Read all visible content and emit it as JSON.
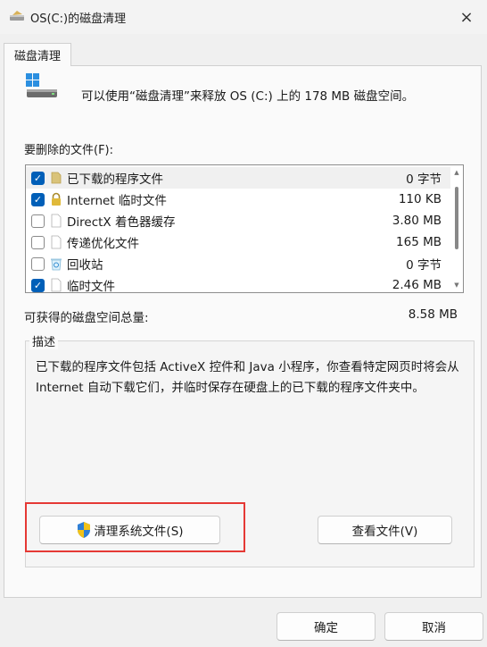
{
  "window": {
    "title": "OS(C:)的磁盘清理",
    "close_icon": "×"
  },
  "tab": {
    "label": "磁盘清理"
  },
  "header": {
    "intro": "可以使用“磁盘清理”来释放 OS (C:) 上的 178 MB 磁盘空间。"
  },
  "files": {
    "label": "要删除的文件(F):",
    "items": [
      {
        "checked": true,
        "icon": "folder-icon",
        "name": "已下载的程序文件",
        "size": "0 字节"
      },
      {
        "checked": true,
        "icon": "lock-icon",
        "name": "Internet 临时文件",
        "size": "110 KB"
      },
      {
        "checked": false,
        "icon": "file-icon",
        "name": "DirectX 着色器缓存",
        "size": "3.80 MB"
      },
      {
        "checked": false,
        "icon": "file-icon",
        "name": "传递优化文件",
        "size": "165 MB"
      },
      {
        "checked": false,
        "icon": "recycle-bin-icon",
        "name": "回收站",
        "size": "0 字节"
      },
      {
        "checked": true,
        "icon": "file-icon",
        "name": "临时文件",
        "size": "2.46 MB"
      }
    ]
  },
  "total": {
    "label": "可获得的磁盘空间总量:",
    "value": "8.58 MB"
  },
  "description": {
    "title": "描述",
    "text": "已下载的程序文件包括 ActiveX 控件和 Java 小程序，你查看特定网页时将会从 Internet 自动下载它们，并临时保存在硬盘上的已下载的程序文件夹中。"
  },
  "buttons": {
    "clean_system": "清理系统文件(S)",
    "view_files": "查看文件(V)",
    "ok": "确定",
    "cancel": "取消"
  },
  "colors": {
    "accent": "#005fb8",
    "highlight_border": "#e53935"
  }
}
